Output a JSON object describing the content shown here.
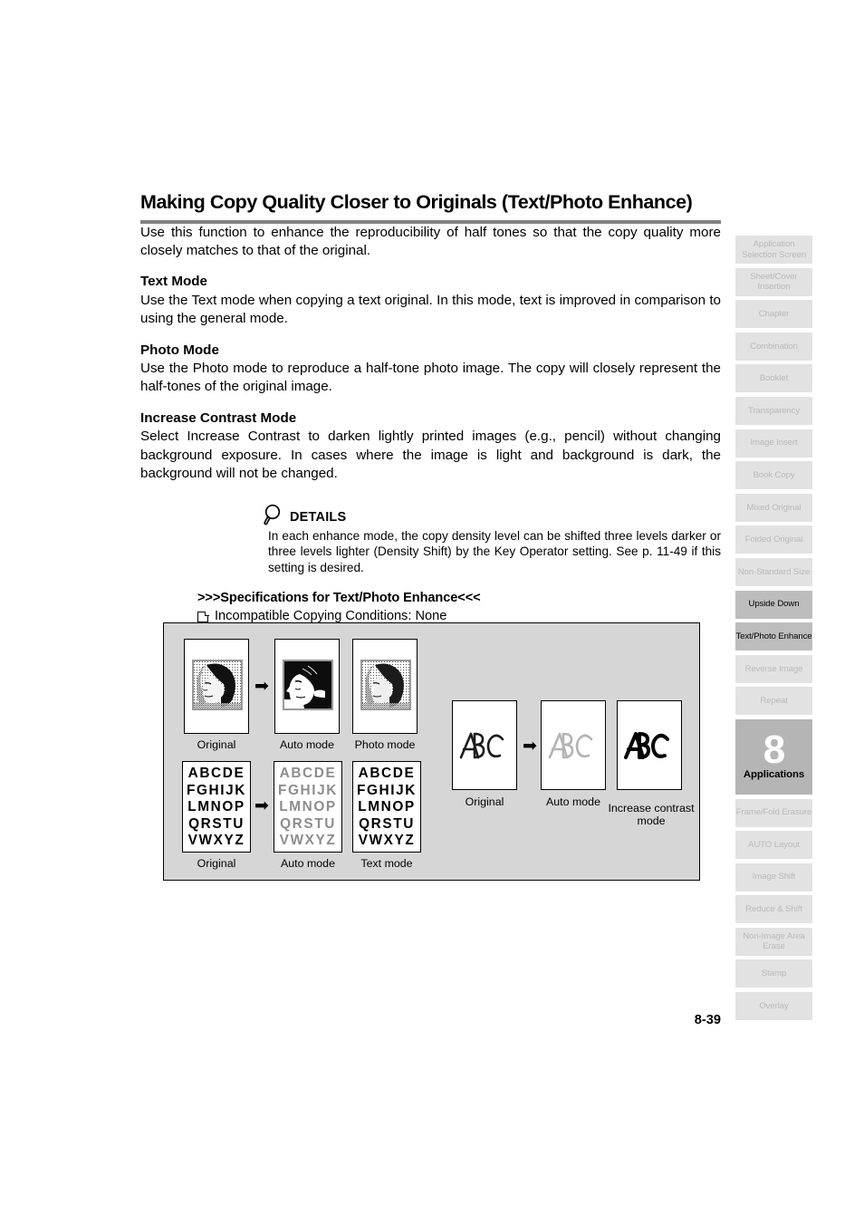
{
  "page": {
    "title": "Making Copy Quality Closer to Originals (Text/Photo Enhance)",
    "number": "8-39"
  },
  "intro": "Use this function to enhance the reproducibility of half tones so that the copy quality more closely matches to that of the original.",
  "sections": [
    {
      "heading": "Text Mode",
      "body": "Use the Text mode when copying a text original. In this mode, text is improved in comparison to using the general mode."
    },
    {
      "heading": "Photo Mode",
      "body": "Use the Photo mode to reproduce a half-tone photo image. The copy will closely represent the half-tones of the original image."
    },
    {
      "heading": "Increase Contrast Mode",
      "body": "Select Increase Contrast to darken lightly printed images (e.g., pencil) without changing background exposure. In cases where the image is light and background is dark, the background will not be changed."
    }
  ],
  "details": {
    "label": "DETAILS",
    "icon": "magnifier-icon",
    "body": "In each enhance mode, the copy density level can be shifted three levels darker or three levels lighter (Density Shift) by the Key Operator setting. See p. 11-49 if this setting is desired."
  },
  "specifications": {
    "title": ">>>Specifications for Text/Photo Enhance<<<",
    "items": [
      "Incompatible Copying Conditions: None"
    ]
  },
  "figure": {
    "photo_row": {
      "captions": [
        "Original",
        "Auto mode",
        "Photo mode"
      ]
    },
    "alpha_row": {
      "captions": [
        "Original",
        "Auto mode",
        "Text mode"
      ],
      "lines": [
        "ABCDE",
        "FGHIJK",
        "LMNOP",
        "QRSTU",
        "VWXYZ"
      ]
    },
    "abc_row": {
      "captions": [
        "Original",
        "Auto mode",
        "Increase contrast mode"
      ],
      "glyph": "ABC"
    },
    "arrow_glyph": "➡"
  },
  "sidebar": {
    "tabs": [
      {
        "label": "Application Selection Screen",
        "state": "inactive"
      },
      {
        "label": "Sheet/Cover Insertion",
        "state": "inactive"
      },
      {
        "label": "Chapter",
        "state": "inactive"
      },
      {
        "label": "Combination",
        "state": "inactive"
      },
      {
        "label": "Booklet",
        "state": "inactive"
      },
      {
        "label": "Transparency",
        "state": "inactive"
      },
      {
        "label": "Image Insert",
        "state": "inactive"
      },
      {
        "label": "Book Copy",
        "state": "inactive"
      },
      {
        "label": "Mixed Original",
        "state": "inactive"
      },
      {
        "label": "Folded Original",
        "state": "inactive"
      },
      {
        "label": "Non-Standard Size",
        "state": "inactive"
      },
      {
        "label": "Upside Down",
        "state": "active"
      },
      {
        "label": "Text/Photo Enhance",
        "state": "active"
      },
      {
        "label": "Reverse Image",
        "state": "inactive"
      },
      {
        "label": "Repeat",
        "state": "inactive"
      }
    ],
    "chapter_marker": {
      "number": "8",
      "word": "Applications"
    },
    "tabs_after": [
      {
        "label": "Frame/Fold Erasure",
        "state": "inactive"
      },
      {
        "label": "AUTO Layout",
        "state": "inactive"
      },
      {
        "label": "Image Shift",
        "state": "inactive"
      },
      {
        "label": "Reduce & Shift",
        "state": "inactive"
      },
      {
        "label": "Non-Image Area Erase",
        "state": "inactive"
      },
      {
        "label": "Stamp",
        "state": "inactive"
      },
      {
        "label": "Overlay",
        "state": "inactive"
      }
    ]
  },
  "colors": {
    "figure_bg": "#d6d6d6",
    "tab_bg": "#e2e2e2",
    "tab_text": "#b9b9b9",
    "tab_active_bg": "#bdbdbd",
    "chapter_bg": "#b5b5b5",
    "rule": "#808080"
  }
}
